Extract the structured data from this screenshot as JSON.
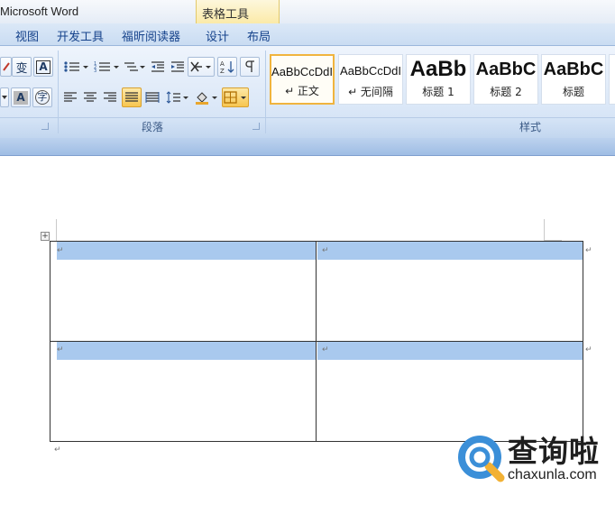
{
  "window": {
    "title": "Microsoft Word",
    "contextual_group": "表格工具"
  },
  "tabs": [
    "视图",
    "开发工具",
    "福昕阅读器",
    "设计",
    "布局"
  ],
  "ribbon": {
    "groups": {
      "paragraph": "段落",
      "styles": "样式"
    },
    "styles": [
      {
        "sample": "AaBbCcDdI",
        "name": "↵ 正文",
        "selected": true
      },
      {
        "sample": "AaBbCcDdI",
        "name": "↵ 无间隔",
        "selected": false
      },
      {
        "sample": "AaBb",
        "name": "标题 1",
        "selected": false
      },
      {
        "sample": "AaBbC",
        "name": "标题 2",
        "selected": false
      },
      {
        "sample": "AaBbC",
        "name": "标题",
        "selected": false
      }
    ],
    "font_glyphs": {
      "phonetic": "变",
      "char_border": "A",
      "char_shade": "A",
      "enclosed": "字"
    }
  },
  "document": {
    "table": {
      "rows": 2,
      "cols": 2,
      "cell_marks": [
        "↵",
        "↵",
        "↵",
        "↵"
      ],
      "row_end_marks": [
        "↵",
        "↵"
      ]
    },
    "para_after_table": "↵",
    "table_move_handle": "+"
  },
  "watermark": {
    "text": "查询啦",
    "url": "chaxunla.com",
    "accent": "#3b8fd8",
    "accent2": "#f2b134"
  }
}
